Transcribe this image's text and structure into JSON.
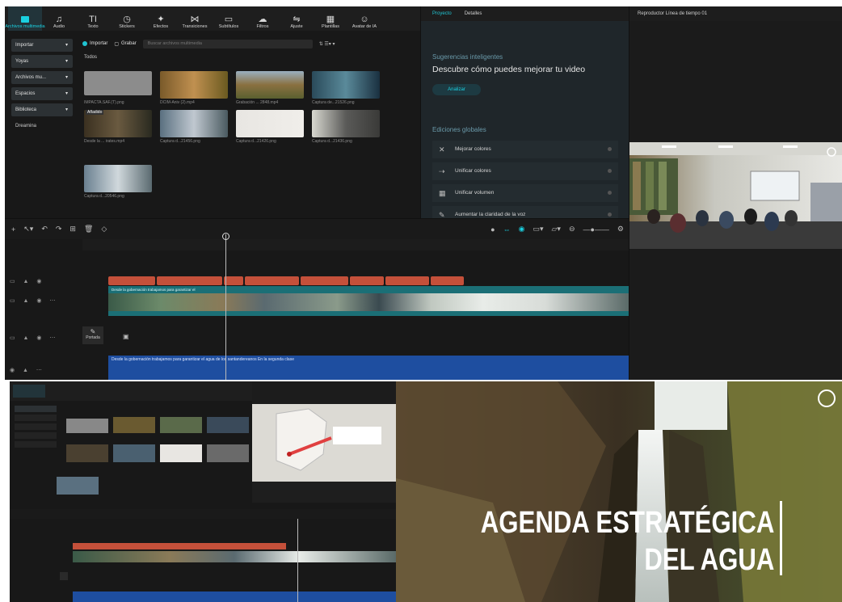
{
  "toolbar": {
    "items": [
      {
        "label": "Archivos multimedia",
        "icon": "media-icon"
      },
      {
        "label": "Audio",
        "icon": "audio-icon"
      },
      {
        "label": "Texto",
        "icon": "text-icon"
      },
      {
        "label": "Stickers",
        "icon": "sticker-icon"
      },
      {
        "label": "Efectos",
        "icon": "effects-icon"
      },
      {
        "label": "Transiciones",
        "icon": "transition-icon"
      },
      {
        "label": "Subtítulos",
        "icon": "subtitle-icon"
      },
      {
        "label": "Filtros",
        "icon": "filter-icon"
      },
      {
        "label": "Ajuste",
        "icon": "adjust-icon"
      },
      {
        "label": "Plantillas",
        "icon": "template-icon"
      },
      {
        "label": "Avatar de IA",
        "icon": "avatar-icon"
      }
    ]
  },
  "left_nav": {
    "items": [
      "Importar",
      "Yoyas",
      "Archivos mu...",
      "Espacios",
      "Biblioteca",
      "Dreamina"
    ]
  },
  "media": {
    "import_label": "Importar",
    "record_label": "Grabar",
    "search_placeholder": "Buscar archivos multimedia",
    "section_label": "Todos",
    "thumbs": [
      {
        "caption": "IMPACTA.SAF.(T).png"
      },
      {
        "caption": "DCIM-Aniv (2).mp4"
      },
      {
        "caption": "Grabación ... 2848.mp4"
      },
      {
        "caption": "Captura de...21526.png"
      },
      {
        "caption": "Desde la ... irates.mp4"
      },
      {
        "caption": "Captura d...21456.png"
      },
      {
        "caption": "Captura d...21426.png"
      },
      {
        "caption": "Captura d...21436.png"
      },
      {
        "caption": "Captura d...20546.png"
      }
    ],
    "added_badge": "Añadido"
  },
  "right_panel": {
    "tab_project": "Proyecto",
    "tab_details": "Detalles",
    "suggestions_title": "Sugerencias inteligentes",
    "suggestions_text": "Descubre cómo puedes mejorar tu video",
    "analyze_label": "Analizar",
    "global_title": "Ediciones globales",
    "global_items": [
      "Mejorar colores",
      "Unificar colores",
      "Unificar volumen",
      "Aumentar la claridad de la voz"
    ]
  },
  "player": {
    "title": "Reproductor Línea de tiempo 01"
  },
  "timeline": {
    "clip_label": "Desde la gobernación trabajamos para garantizar el",
    "audio_label": "Desde la gobernación trabajamos para garantizar el agua de los santandereanos En la segunda clase",
    "portada_label": "Portada"
  },
  "preview_bottom": {
    "title_line1": "AGENDA ESTRATÉGICA",
    "title_line2": "DEL AGUA"
  },
  "colors": {
    "accent": "#1ad0e0",
    "bg": "#181818",
    "clip_red": "#c4503a",
    "clip_teal": "#1b6f76",
    "audio_blue": "#1e4ea0"
  }
}
